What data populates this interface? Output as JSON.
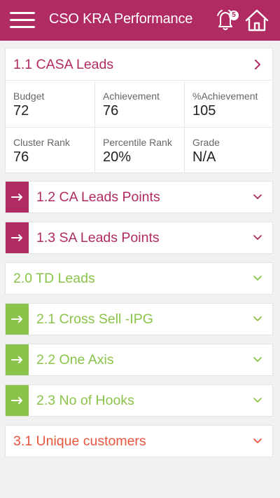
{
  "header": {
    "title": "CSO KRA Performance",
    "notification_count": "5",
    "menu_icon": "hamburger-menu-icon",
    "bell_icon": "bell-icon",
    "home_icon": "home-icon"
  },
  "colors": {
    "header_bg": "#b12b63",
    "casa": "#b12b63",
    "td": "#8bc34a",
    "unique": "#e8553c"
  },
  "casa_card": {
    "title": "1.1 CASA Leads",
    "metrics": [
      {
        "label": "Budget",
        "value": "72"
      },
      {
        "label": "Achievement",
        "value": "76"
      },
      {
        "label": "%Achievement",
        "value": "105"
      },
      {
        "label": "Cluster Rank",
        "value": "76"
      },
      {
        "label": "Percentile Rank",
        "value": "20%"
      },
      {
        "label": "Grade",
        "value": "N/A"
      }
    ]
  },
  "sections": [
    {
      "label": "1.2 CA Leads Points"
    },
    {
      "label": "1.3 SA Leads Points"
    },
    {
      "label": "2.0 TD Leads"
    },
    {
      "label": "2.1 Cross Sell -IPG"
    },
    {
      "label": "2.2 One Axis"
    },
    {
      "label": "2.3 No of Hooks"
    },
    {
      "label": "3.1 Unique customers"
    }
  ]
}
